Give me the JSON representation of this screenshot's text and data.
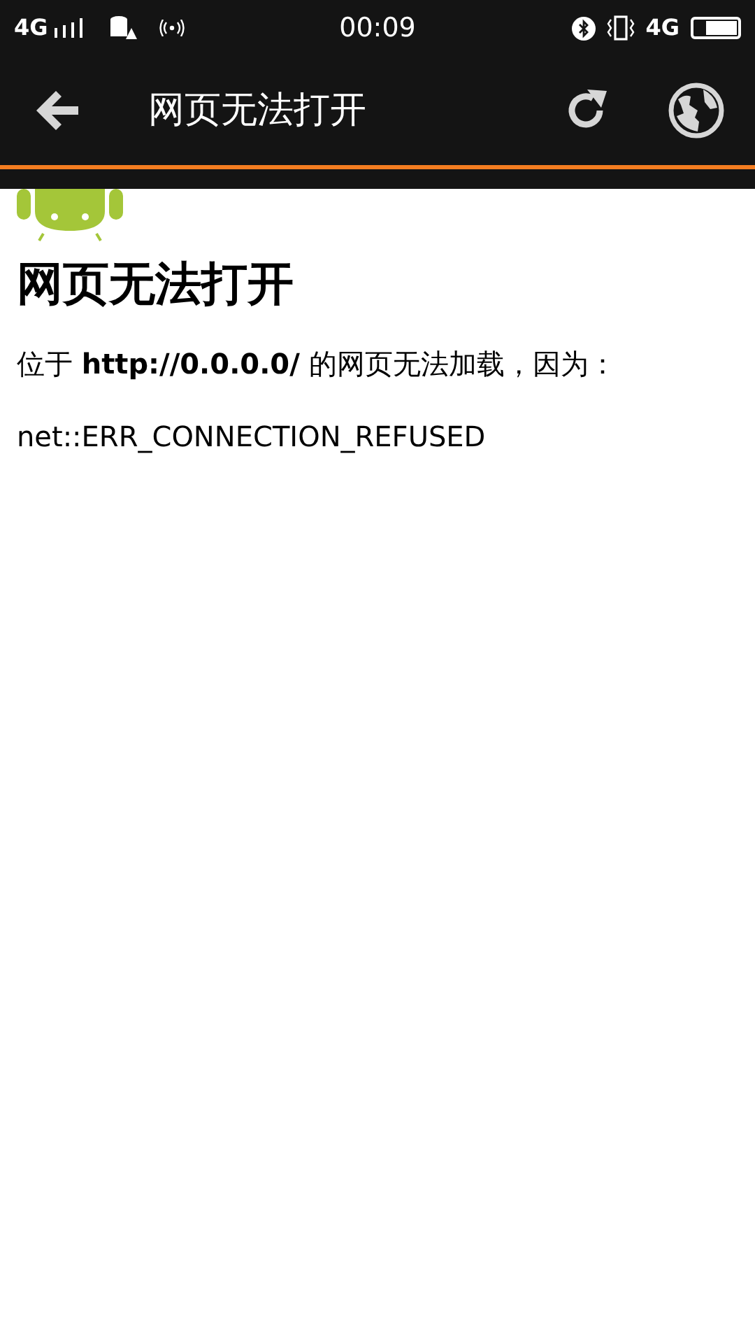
{
  "status_bar": {
    "network_left": "4G",
    "time": "00:09",
    "network_right": "4G"
  },
  "toolbar": {
    "title": "网页无法打开"
  },
  "page": {
    "heading": "网页无法打开",
    "message": "位于 **http://0.0.0.0/** 的网页无法加载，因为：",
    "error": "net::ERR_CONNECTION_REFUSED"
  }
}
